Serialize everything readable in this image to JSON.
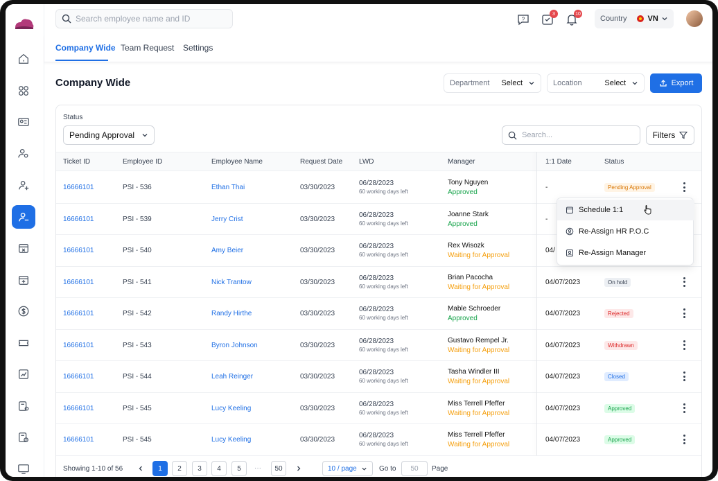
{
  "top": {
    "search_placeholder": "Search employee name and ID",
    "notif_count": "3",
    "bell_count": "10",
    "country_label": "Country",
    "country_code": "VN"
  },
  "tabs": [
    {
      "label": "Company Wide"
    },
    {
      "label": "Team Request"
    },
    {
      "label": "Settings"
    }
  ],
  "page": {
    "title": "Company Wide",
    "department_label": "Department",
    "department_value": "Select",
    "location_label": "Location",
    "location_value": "Select",
    "export_label": "Export"
  },
  "filters": {
    "status_label": "Status",
    "status_value": "Pending Approval",
    "search_placeholder": "Search...",
    "filters_label": "Filters"
  },
  "columns": [
    "Ticket ID",
    "Employee ID",
    "Employee Name",
    "Request Date",
    "LWD",
    "Manager",
    "1:1 Date",
    "Status"
  ],
  "rows": [
    {
      "ticket": "16666101",
      "emp_id": "PSI - 536",
      "name": "Ethan Thai",
      "req": "03/30/2023",
      "lwd": "06/28/2023",
      "left": "60 working days left",
      "manager": "Tony Nguyen",
      "mstatus": "Approved",
      "date11": "-",
      "status": "Pending Approval"
    },
    {
      "ticket": "16666101",
      "emp_id": "PSI - 539",
      "name": "Jerry Crist",
      "req": "03/30/2023",
      "lwd": "06/28/2023",
      "left": "60 working days left",
      "manager": "Joanne Stark",
      "mstatus": "Approved",
      "date11": "-",
      "status": ""
    },
    {
      "ticket": "16666101",
      "emp_id": "PSI - 540",
      "name": "Amy Beier",
      "req": "03/30/2023",
      "lwd": "06/28/2023",
      "left": "60 working days left",
      "manager": "Rex Wisozk",
      "mstatus": "Waiting for Approval",
      "date11": "04/",
      "status": ""
    },
    {
      "ticket": "16666101",
      "emp_id": "PSI - 541",
      "name": "Nick Trantow",
      "req": "03/30/2023",
      "lwd": "06/28/2023",
      "left": "60 working days left",
      "manager": "Brian Pacocha",
      "mstatus": "Waiting for Approval",
      "date11": "04/07/2023",
      "status": "On hold"
    },
    {
      "ticket": "16666101",
      "emp_id": "PSI - 542",
      "name": "Randy Hirthe",
      "req": "03/30/2023",
      "lwd": "06/28/2023",
      "left": "60 working days left",
      "manager": "Mable Schroeder",
      "mstatus": "Approved",
      "date11": "04/07/2023",
      "status": "Rejected"
    },
    {
      "ticket": "16666101",
      "emp_id": "PSI - 543",
      "name": "Byron Johnson",
      "req": "03/30/2023",
      "lwd": "06/28/2023",
      "left": "60 working days left",
      "manager": "Gustavo Rempel Jr.",
      "mstatus": "Waiting for Approval",
      "date11": "04/07/2023",
      "status": "Withdrawn"
    },
    {
      "ticket": "16666101",
      "emp_id": "PSI - 544",
      "name": "Leah Reinger",
      "req": "03/30/2023",
      "lwd": "06/28/2023",
      "left": "60 working days left",
      "manager": "Tasha Windler III",
      "mstatus": "Waiting for Approval",
      "date11": "04/07/2023",
      "status": "Closed"
    },
    {
      "ticket": "16666101",
      "emp_id": "PSI - 545",
      "name": "Lucy Keeling",
      "req": "03/30/2023",
      "lwd": "06/28/2023",
      "left": "60 working days left",
      "manager": "Miss Terrell Pfeffer",
      "mstatus": "Waiting for Approval",
      "date11": "04/07/2023",
      "status": "Approved"
    },
    {
      "ticket": "16666101",
      "emp_id": "PSI - 545",
      "name": "Lucy Keeling",
      "req": "03/30/2023",
      "lwd": "06/28/2023",
      "left": "60 working days left",
      "manager": "Miss Terrell Pfeffer",
      "mstatus": "Waiting for Approval",
      "date11": "04/07/2023",
      "status": "Approved"
    }
  ],
  "status_colors": {
    "Pending Approval": [
      "#fff4e5",
      "#d97706"
    ],
    "On hold": [
      "#eceff3",
      "#374151"
    ],
    "Rejected": [
      "#fde8e8",
      "#dc2626"
    ],
    "Withdrawn": [
      "#fde8e8",
      "#dc2626"
    ],
    "Closed": [
      "#e0ecff",
      "#1f6fe5"
    ],
    "Approved": [
      "#dcfce7",
      "#16a34a"
    ]
  },
  "menu": [
    {
      "label": "Schedule 1:1",
      "icon": "calendar-icon"
    },
    {
      "label": "Re-Assign HR P.O.C",
      "icon": "user-badge-icon"
    },
    {
      "label": "Re-Assign Manager",
      "icon": "user-card-icon"
    }
  ],
  "pagination": {
    "showing": "Showing 1-10 of 56",
    "pages": [
      "1",
      "2",
      "3",
      "4",
      "5"
    ],
    "ellipsis": "···",
    "last": "50",
    "per_page": "10 / page",
    "goto_label": "Go to",
    "goto_value": "50",
    "page_label": "Page"
  }
}
